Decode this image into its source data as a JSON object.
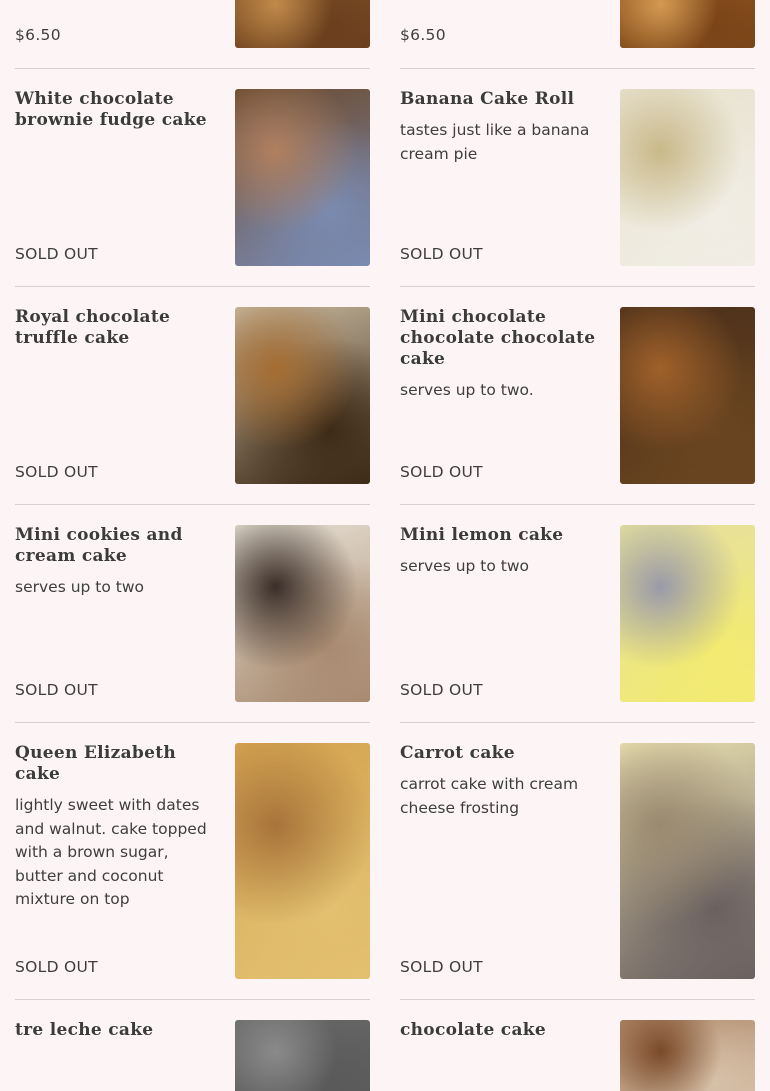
{
  "menu": {
    "items": [
      {
        "name": "",
        "description": "",
        "status": "$6.50",
        "image_icon": "cake-photo",
        "palette": [
          "#8a5a2a",
          "#c08a4a",
          "#6b3f1e"
        ]
      },
      {
        "name": "",
        "description": "",
        "status": "$6.50",
        "image_icon": "cake-photo",
        "palette": [
          "#9a5e25",
          "#d49a52",
          "#7a4418"
        ]
      },
      {
        "name": "White chocolate brownie fudge cake",
        "description": "",
        "status": "SOLD OUT",
        "image_icon": "cake-photo",
        "palette": [
          "#6b4a2e",
          "#b08060",
          "#7a8ab0"
        ]
      },
      {
        "name": "Banana Cake Roll",
        "description": "tastes just like a banana cream pie",
        "status": "SOLD OUT",
        "image_icon": "cake-photo",
        "palette": [
          "#e8e2cf",
          "#c9b98a",
          "#f0ede4"
        ]
      },
      {
        "name": "Royal chocolate truffle cake",
        "description": "",
        "status": "SOLD OUT",
        "image_icon": "cake-photo",
        "palette": [
          "#c8b9a0",
          "#a56d32",
          "#3d2a17"
        ]
      },
      {
        "name": "Mini chocolate chocolate chocolate cake",
        "description": "serves up to two.",
        "status": "SOLD OUT",
        "image_icon": "cake-photo",
        "palette": [
          "#4a2f1a",
          "#a0612a",
          "#6a4520"
        ]
      },
      {
        "name": "Mini cookies and cream cake",
        "description": "serves up to two",
        "status": "SOLD OUT",
        "image_icon": "cake-photo",
        "palette": [
          "#e8e2d6",
          "#3a2e28",
          "#a88a70"
        ]
      },
      {
        "name": "Mini lemon cake",
        "description": "serves up to two",
        "status": "SOLD OUT",
        "image_icon": "cake-photo",
        "palette": [
          "#e6e0a0",
          "#9a9aa8",
          "#f2ea70"
        ]
      },
      {
        "name": "Queen Elizabeth cake",
        "description": "lightly sweet with dates and walnut. cake topped with a brown sugar, butter and coconut mixture on top",
        "status": "SOLD OUT",
        "image_icon": "cake-photo",
        "palette": [
          "#d4a450",
          "#a8743a",
          "#e2c070"
        ]
      },
      {
        "name": "Carrot cake",
        "description": "carrot cake with cream cheese frosting",
        "status": "SOLD OUT",
        "image_icon": "cake-photo",
        "palette": [
          "#eae0b0",
          "#9a8a70",
          "#6a6060"
        ]
      },
      {
        "name": "tre leche cake",
        "description": "",
        "status": "",
        "image_icon": "cake-photo",
        "palette": [
          "#6a6a6a",
          "#8a8a8a",
          "#5a5a5a"
        ]
      },
      {
        "name": "chocolate cake",
        "description": "",
        "status": "",
        "image_icon": "cake-photo",
        "palette": [
          "#b08a6a",
          "#7a4a2a",
          "#d6c0a8"
        ]
      }
    ]
  }
}
